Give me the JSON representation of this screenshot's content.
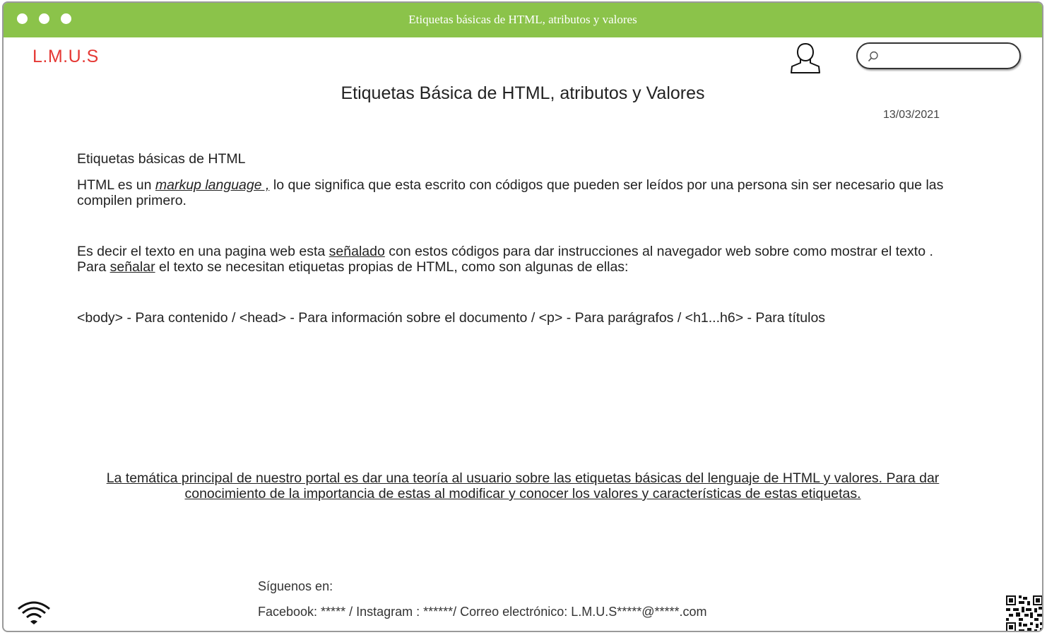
{
  "window": {
    "title": "Etiquetas básicas de HTML, atributos y valores"
  },
  "header": {
    "logo": "L.M.U.S",
    "search": {
      "value": "",
      "placeholder": ""
    },
    "icons": [
      "user-icon",
      "search-icon"
    ]
  },
  "main": {
    "title": "Etiquetas Básica de HTML, atributos y Valores",
    "date": "13/03/2021",
    "heading": "Etiquetas básicas de HTML",
    "p1": {
      "a": "HTML es un ",
      "link": "markup language ,",
      "b": " lo que significa que esta escrito con códigos que pueden ser leídos por una persona sin ser necesario que las compilen primero."
    },
    "p2": {
      "a": "Es decir el texto en una pagina web esta ",
      "link1": "señalado",
      "b": " con estos códigos para dar instrucciones al navegador web sobre como mostrar el texto .",
      "c": "Para ",
      "link2": "señalar",
      "d": " el texto se necesitan etiquetas propias de HTML, como son algunas de ellas:"
    },
    "tags_line": "<body> - Para contenido / <head> - Para información sobre el documento / <p> - Para parágrafos / <h1...h6> - Para títulos",
    "summary_line1": "La  temática principal de nuestro portal es dar una teoría al usuario sobre las etiquetas básicas del lenguaje de HTML y valores. Para dar",
    "summary_line2": "conocimiento de la importancia de estas al modificar y conocer los valores y características de estas etiquetas."
  },
  "footer": {
    "follow_label": "Síguenos en:",
    "contacts": "Facebook: ***** / Instagram : ******/ Correo electrónico: L.M.U.S*****@*****.com",
    "icons": [
      "wifi-icon",
      "qr-code-icon"
    ]
  },
  "colors": {
    "titlebar": "#8bc34a",
    "logo": "#e53935"
  }
}
